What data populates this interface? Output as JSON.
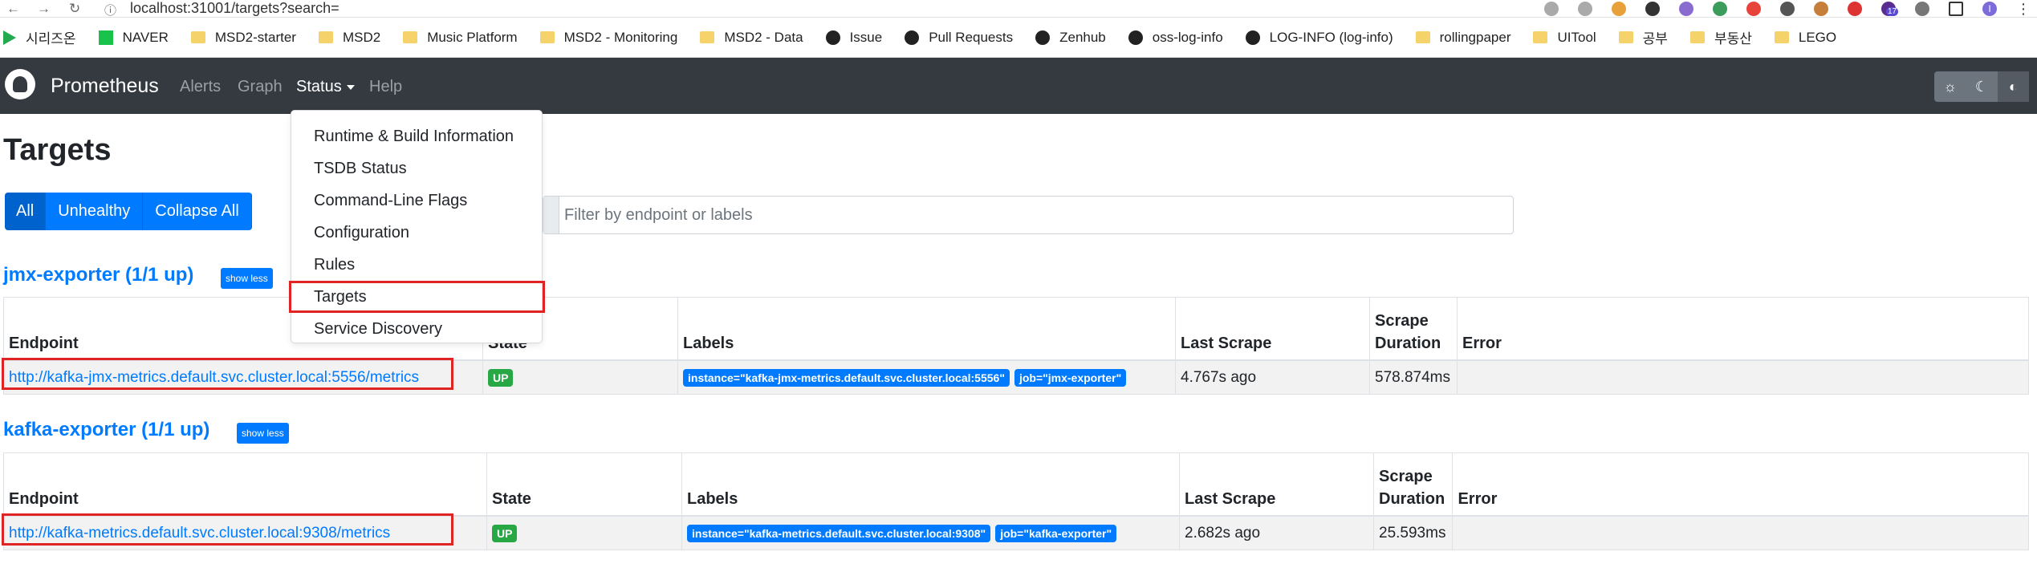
{
  "browser": {
    "url": "localhost:31001/targets?search=",
    "bookmarks": [
      {
        "label": "시리즈온",
        "icon": "play-icon"
      },
      {
        "label": "NAVER",
        "icon": "naver-icon"
      },
      {
        "label": "MSD2-starter",
        "icon": "folder-icon"
      },
      {
        "label": "MSD2",
        "icon": "folder-icon"
      },
      {
        "label": "Music Platform",
        "icon": "folder-icon"
      },
      {
        "label": "MSD2 - Monitoring",
        "icon": "folder-icon"
      },
      {
        "label": "MSD2 - Data",
        "icon": "folder-icon"
      },
      {
        "label": "Issue",
        "icon": "github-icon"
      },
      {
        "label": "Pull Requests",
        "icon": "github-icon"
      },
      {
        "label": "Zenhub",
        "icon": "github-icon"
      },
      {
        "label": "oss-log-info",
        "icon": "github-icon"
      },
      {
        "label": "LOG-INFO (log-info)",
        "icon": "github-icon"
      },
      {
        "label": "rollingpaper",
        "icon": "folder-icon"
      },
      {
        "label": "UITool",
        "icon": "folder-icon"
      },
      {
        "label": "공부",
        "icon": "folder-icon"
      },
      {
        "label": "부동산",
        "icon": "folder-icon"
      },
      {
        "label": "LEGO",
        "icon": "folder-icon"
      }
    ],
    "extension_badge": "17",
    "profile_initial": "I"
  },
  "navbar": {
    "brand": "Prometheus",
    "links": {
      "alerts": "Alerts",
      "graph": "Graph",
      "status": "Status",
      "help": "Help"
    }
  },
  "status_menu": {
    "items": [
      "Runtime & Build Information",
      "TSDB Status",
      "Command-Line Flags",
      "Configuration",
      "Rules",
      "Targets",
      "Service Discovery"
    ],
    "highlighted": "Targets"
  },
  "page": {
    "title": "Targets",
    "filters": {
      "all": "All",
      "unhealthy": "Unhealthy",
      "collapse": "Collapse All"
    },
    "search_placeholder": "Filter by endpoint or labels"
  },
  "pools": [
    {
      "name": "jmx-exporter (1/1 up)",
      "toggle": "show less",
      "columns": {
        "endpoint": "Endpoint",
        "state": "State",
        "labels": "Labels",
        "last_scrape": "Last Scrape",
        "duration": "Scrape Duration",
        "error": "Error"
      },
      "rows": [
        {
          "endpoint": "http://kafka-jmx-metrics.default.svc.cluster.local:5556/metrics",
          "state": "UP",
          "labels": [
            "instance=\"kafka-jmx-metrics.default.svc.cluster.local:5556\"",
            "job=\"jmx-exporter\""
          ],
          "last_scrape": "4.767s ago",
          "duration": "578.874ms",
          "error": ""
        }
      ]
    },
    {
      "name": "kafka-exporter (1/1 up)",
      "toggle": "show less",
      "columns": {
        "endpoint": "Endpoint",
        "state": "State",
        "labels": "Labels",
        "last_scrape": "Last Scrape",
        "duration": "Scrape Duration",
        "error": "Error"
      },
      "rows": [
        {
          "endpoint": "http://kafka-metrics.default.svc.cluster.local:9308/metrics",
          "state": "UP",
          "labels": [
            "instance=\"kafka-metrics.default.svc.cluster.local:9308\"",
            "job=\"kafka-exporter\""
          ],
          "last_scrape": "2.682s ago",
          "duration": "25.593ms",
          "error": ""
        }
      ]
    }
  ],
  "colors": {
    "primary": "#007bff",
    "navbar": "#343a40",
    "up": "#28a745",
    "highlight_box": "#e02424"
  }
}
